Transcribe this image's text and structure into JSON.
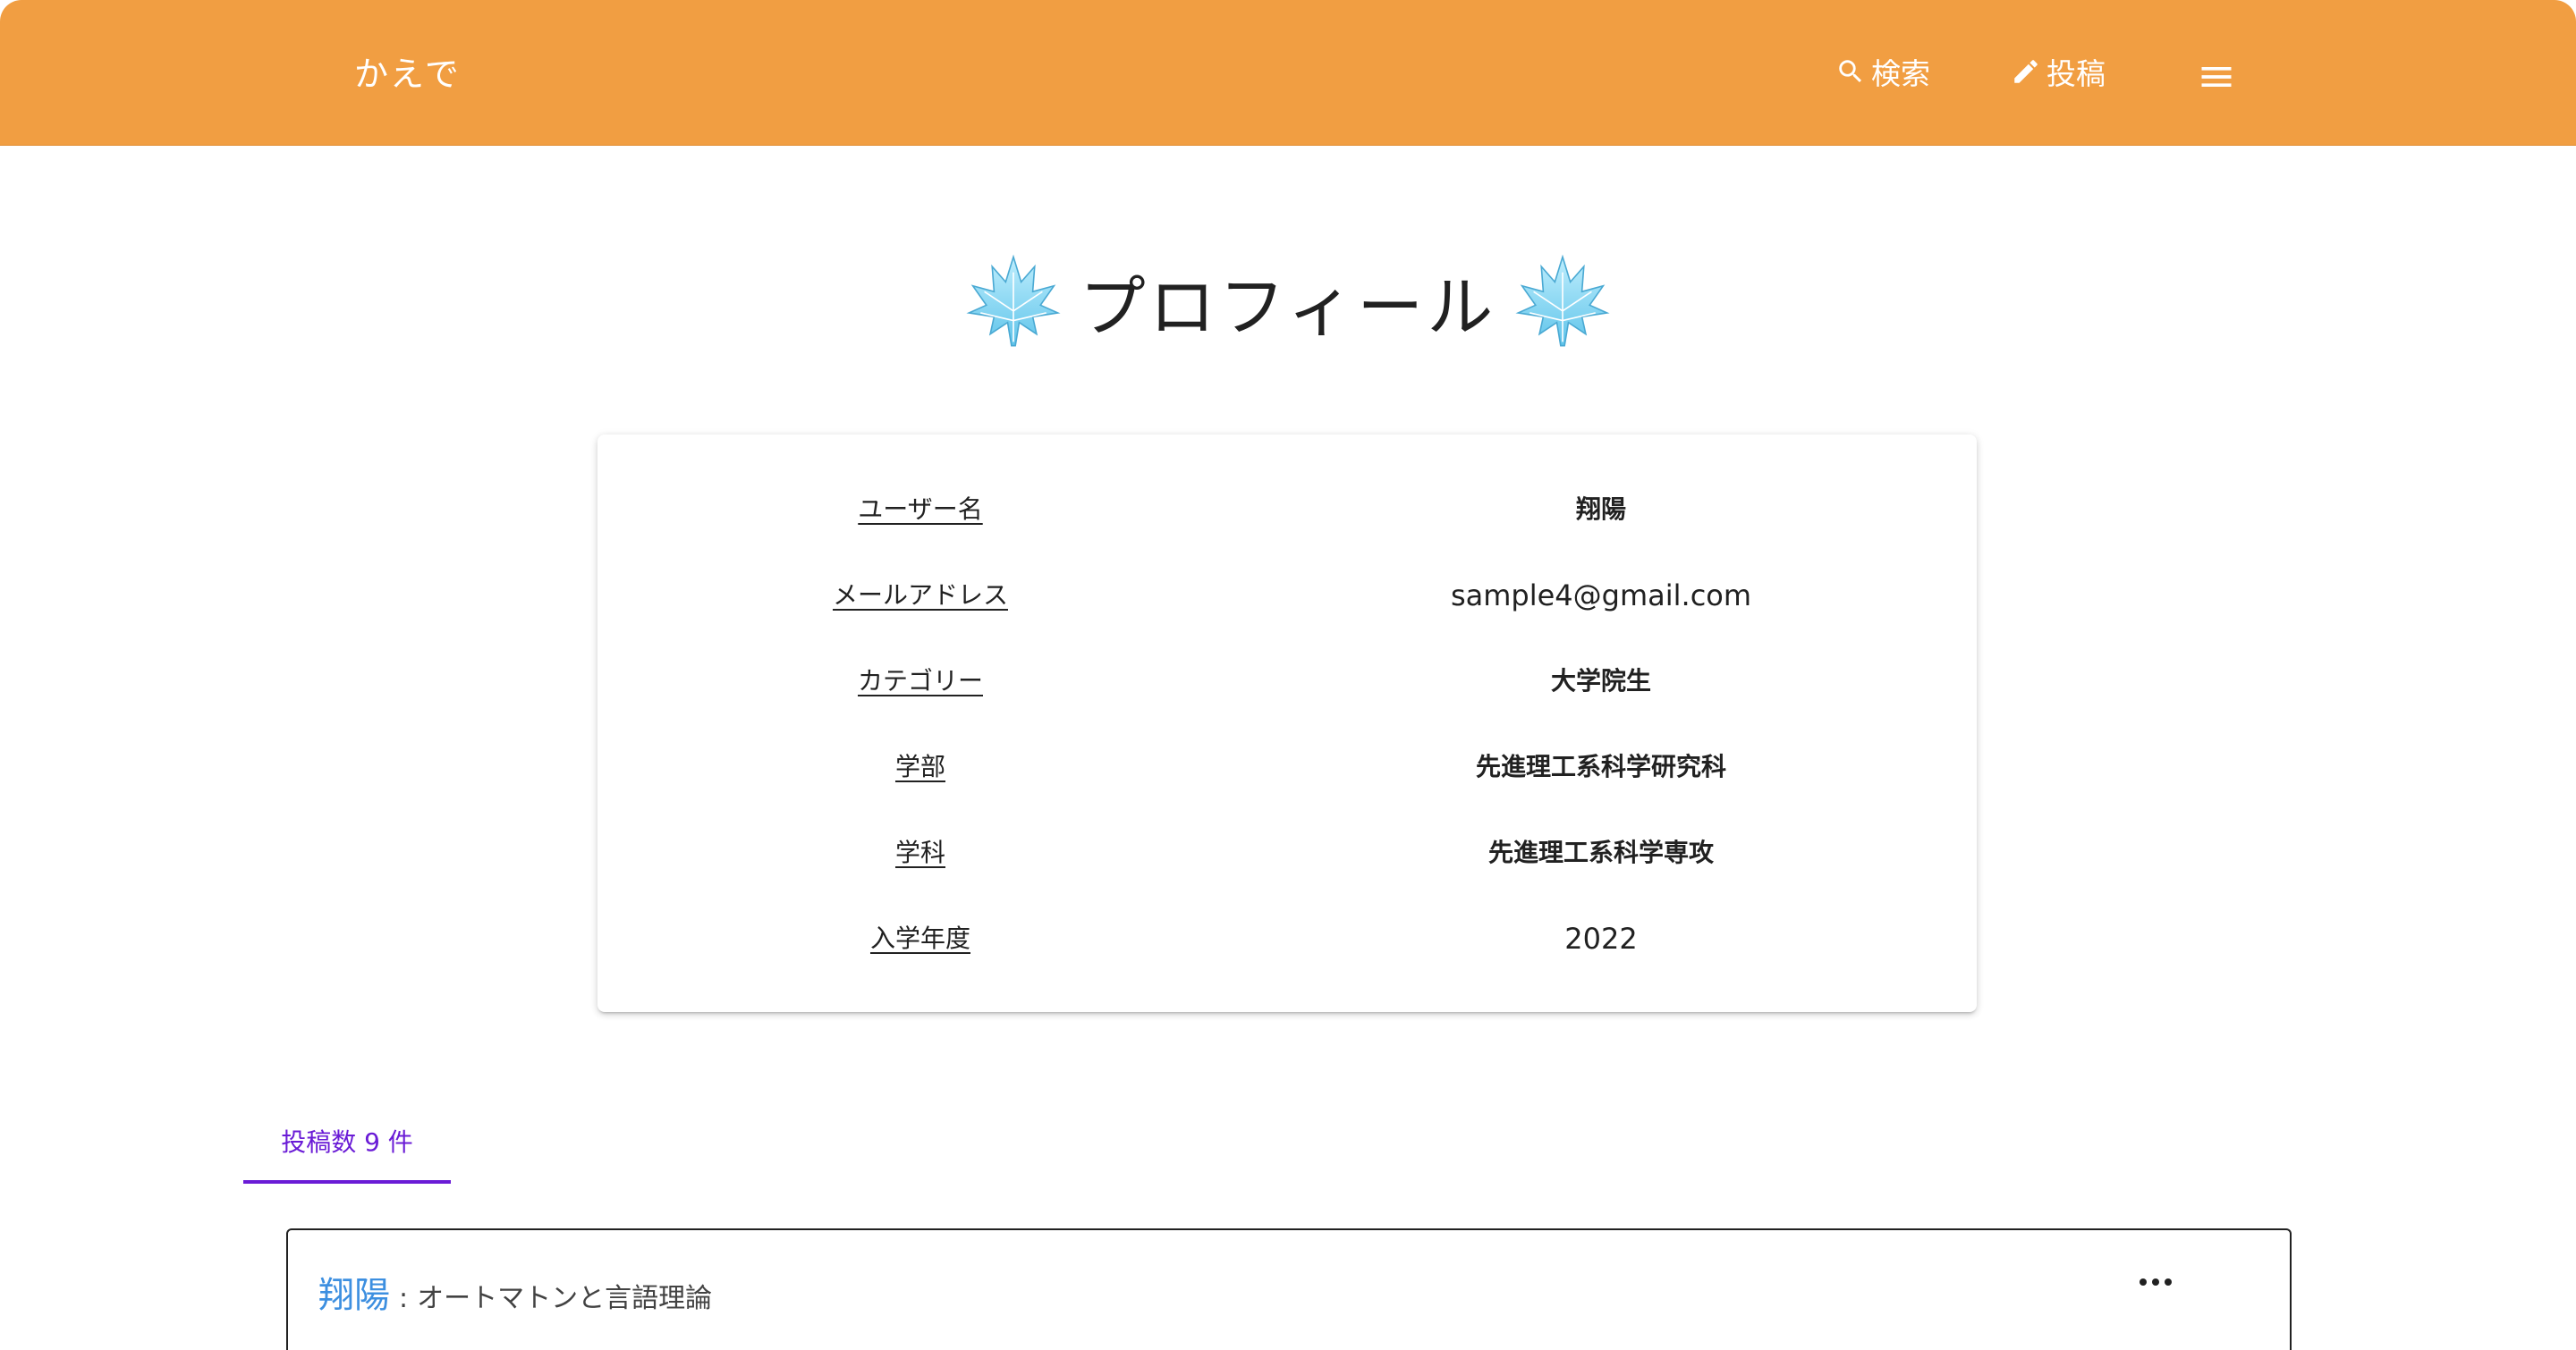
{
  "colors": {
    "appbar": "#f19e42",
    "accent_tab": "#6a1bd6",
    "author_link": "#3d8fe0",
    "leaf": "#7fd3f1"
  },
  "appbar": {
    "brand": "かえで",
    "search_label": "検索",
    "search_icon": "search-icon",
    "post_label": "投稿",
    "post_icon": "pencil-icon",
    "menu_icon": "menu-icon"
  },
  "page": {
    "title": "プロフィール",
    "title_decoration_icon": "maple-leaf-icon"
  },
  "profile": {
    "rows": [
      {
        "label": "ユーザー名",
        "value": "翔陽"
      },
      {
        "label": "メールアドレス",
        "value": "sample4@gmail.com"
      },
      {
        "label": "カテゴリー",
        "value": "大学院生"
      },
      {
        "label": "学部",
        "value": "先進理工系科学研究科"
      },
      {
        "label": "学科",
        "value": "先進理工系科学専攻"
      },
      {
        "label": "入学年度",
        "value": "2022"
      }
    ]
  },
  "tabs": {
    "posts_label": "投稿数 9 件"
  },
  "posts": [
    {
      "author": "翔陽",
      "separator": ":",
      "title": "オートマトンと言語理論",
      "more_icon": "more-horizontal-icon"
    }
  ]
}
